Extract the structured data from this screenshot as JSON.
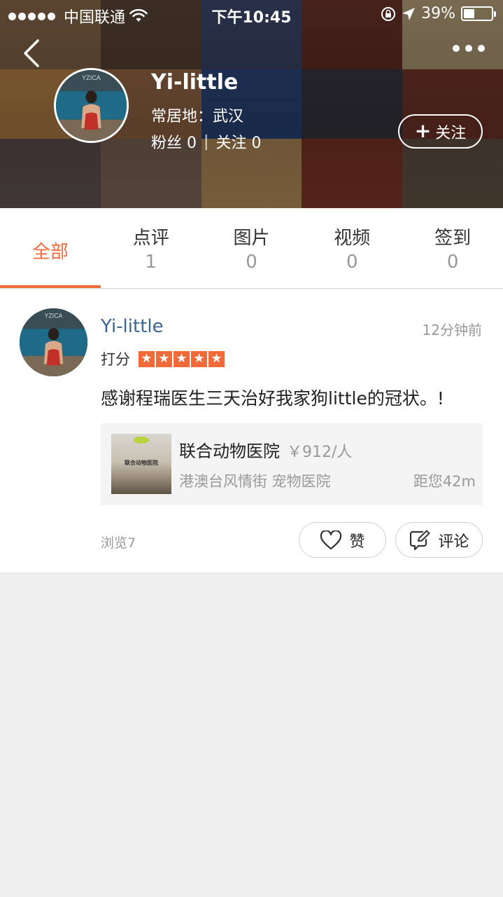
{
  "status_bar": {
    "carrier": "中国联通",
    "time": "下午10:45",
    "battery": "39%",
    "battery_level": 0.39
  },
  "profile": {
    "name": "Yi-little",
    "location": "常居地：武汉",
    "fans_label": "粉丝",
    "fans_count": "0",
    "following_label": "关注",
    "following_count": "0",
    "follow_button_icon": "+",
    "follow_button": "关注",
    "avatar_watermark": "YZICA"
  },
  "tabs": [
    {
      "label": "全部",
      "count": ""
    },
    {
      "label": "点评",
      "count": "1"
    },
    {
      "label": "图片",
      "count": "0"
    },
    {
      "label": "视频",
      "count": "0"
    },
    {
      "label": "签到",
      "count": "0"
    }
  ],
  "post": {
    "user": "Yi-little",
    "time": "12分钟前",
    "rating_label": "打分",
    "rating": 5,
    "text": "感谢程瑞医生三天治好我家狗little的冠状。!",
    "shop": {
      "name": "联合动物医院",
      "price": "￥912/人",
      "category": "港澳台风情街 宠物医院",
      "distance": "距您42m",
      "thumb_sign": "联合动物医院"
    },
    "views": "浏览7",
    "like_label": "赞",
    "comment_label": "评论"
  },
  "colors": {
    "accent": "#f06a3a",
    "link": "#3d6591"
  }
}
